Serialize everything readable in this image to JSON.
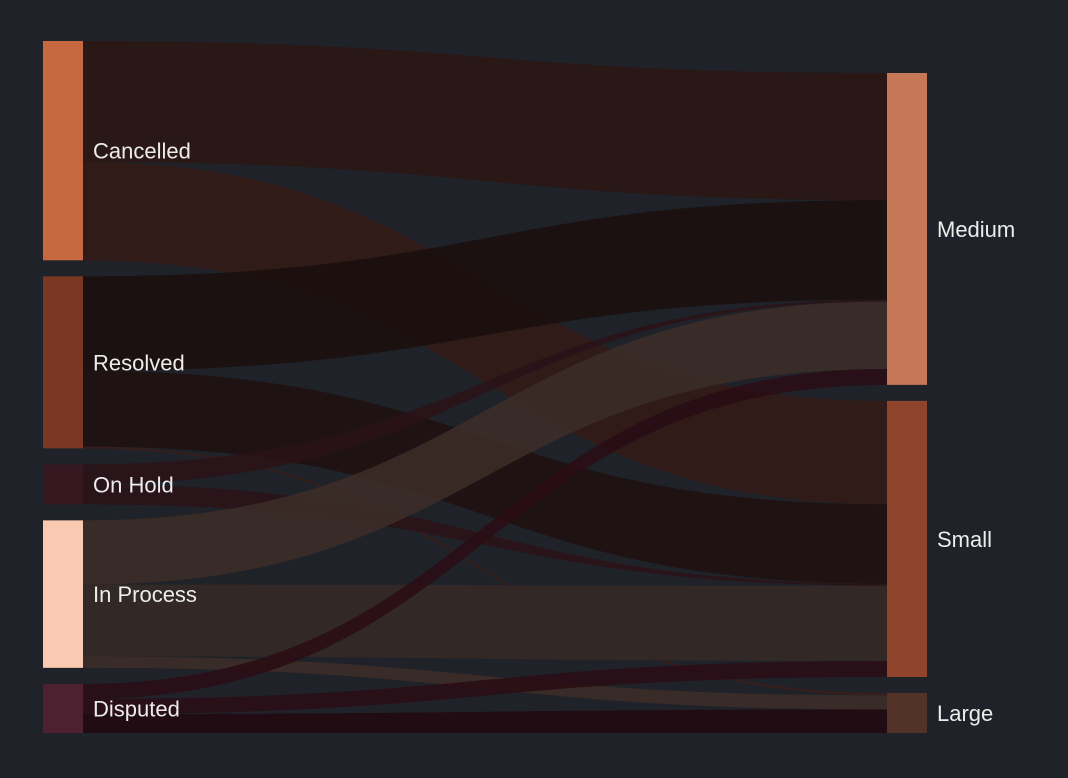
{
  "chart_data": {
    "type": "sankey",
    "source_nodes": [
      {
        "name": "Cancelled",
        "color": "#c76843"
      },
      {
        "name": "Resolved",
        "color": "#7a3824"
      },
      {
        "name": "On Hold",
        "color": "#361820"
      },
      {
        "name": "In Process",
        "color": "#f9c9b1"
      },
      {
        "name": "Disputed",
        "color": "#4e2130"
      }
    ],
    "target_nodes": [
      {
        "name": "Medium",
        "color": "#c67755"
      },
      {
        "name": "Small",
        "color": "#8f452c"
      },
      {
        "name": "Large",
        "color": "#533227"
      }
    ],
    "links": [
      {
        "source": "Cancelled",
        "target": "Medium",
        "value": 32,
        "color": "#2a1714"
      },
      {
        "source": "Cancelled",
        "target": "Small",
        "value": 26,
        "color": "#321b16"
      },
      {
        "source": "Resolved",
        "target": "Medium",
        "value": 25,
        "color": "#1a0f0d"
      },
      {
        "source": "Resolved",
        "target": "Small",
        "value": 20,
        "color": "#1f110f"
      },
      {
        "source": "Resolved",
        "target": "Large",
        "value": 0.5,
        "color": "#3a1d19"
      },
      {
        "source": "On Hold",
        "target": "Medium",
        "value": 0.5,
        "color": "#2a1318"
      },
      {
        "source": "On Hold",
        "target": "Small",
        "value": 0.5,
        "color": "#2a1318"
      },
      {
        "source": "In Process",
        "target": "Medium",
        "value": 17,
        "color": "#3c2c27"
      },
      {
        "source": "In Process",
        "target": "Small",
        "value": 19,
        "color": "#342925"
      },
      {
        "source": "In Process",
        "target": "Large",
        "value": 3,
        "color": "#3c2c27"
      },
      {
        "source": "Disputed",
        "target": "Medium",
        "value": 4,
        "color": "#2a0d15"
      },
      {
        "source": "Disputed",
        "target": "Small",
        "value": 4,
        "color": "#2a0d15"
      },
      {
        "source": "Disputed",
        "target": "Large",
        "value": 5,
        "color": "#210a11"
      }
    ],
    "title": "",
    "legend": "none"
  }
}
